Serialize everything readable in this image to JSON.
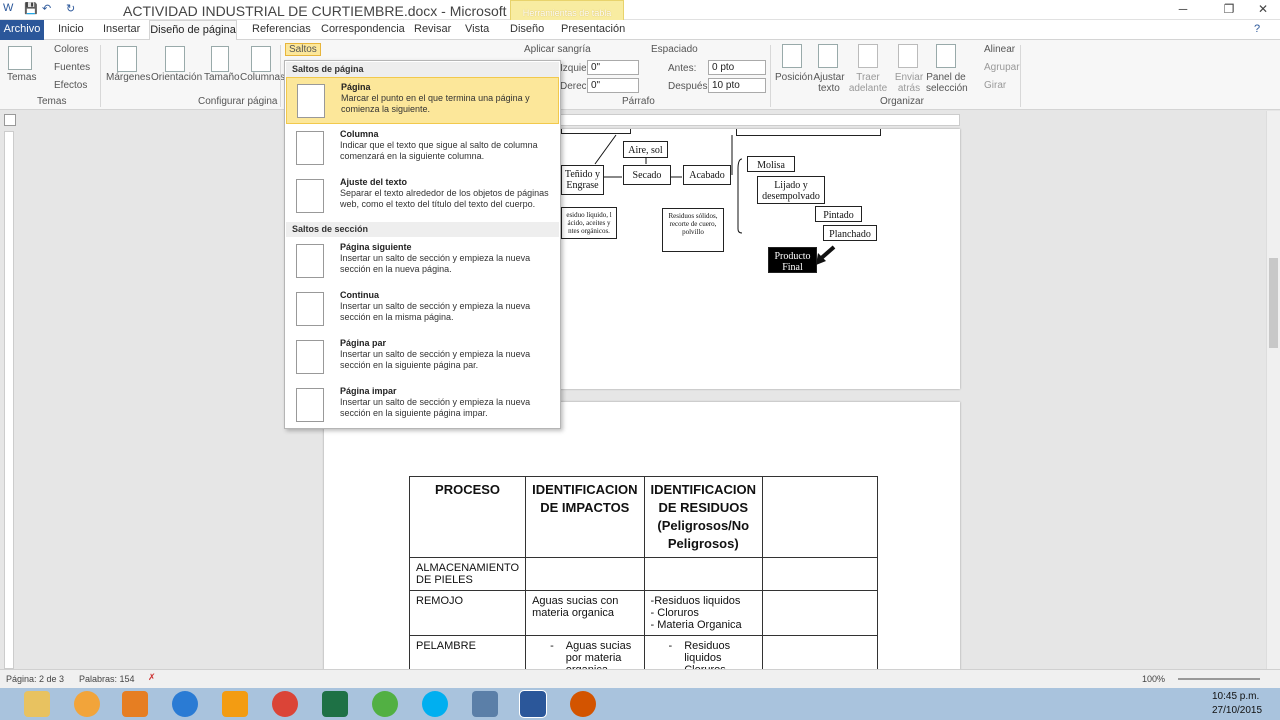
{
  "titlebar": {
    "doc_title": "ACTIVIDAD INDUSTRIAL DE CURTIEMBRE.docx - Microsoft Word",
    "context_tab": "Herramientas de tabla",
    "qa_save": "💾",
    "qa_undo": "↶",
    "qa_redo": "↻",
    "win_help": "?",
    "win_min": "─",
    "win_max": "❐",
    "win_close": "✕"
  },
  "tabs": {
    "file": "Archivo",
    "home": "Inicio",
    "insert": "Insertar",
    "layout": "Diseño de página",
    "references": "Referencias",
    "mailings": "Correspondencia",
    "review": "Revisar",
    "view": "Vista",
    "design": "Diseño",
    "presentation": "Presentación"
  },
  "ribbon": {
    "themes": "Temas",
    "colors": "Colores",
    "fonts": "Fuentes",
    "effects": "Efectos",
    "themes_group": "Temas",
    "margins": "Márgenes",
    "orientation": "Orientación",
    "size": "Tamaño",
    "columns": "Columnas",
    "setup_group": "Configurar página",
    "breaks": "Saltos",
    "indent": "Aplicar sangría",
    "spacing": "Espaciado",
    "left_label": "Izquierda:",
    "left_val": "0\"",
    "right_label": "Derecha:",
    "right_val": "0\"",
    "before_label": "Antes:",
    "before_val": "0 pto",
    "after_label": "Después:",
    "after_val": "10 pto",
    "paragraph_group": "Párrafo",
    "position": "Posición",
    "wrap": "Ajustar texto",
    "bring": "Traer adelante",
    "send": "Enviar atrás",
    "selection": "Panel de selección",
    "align": "Alinear",
    "group": "Agrupar",
    "rotate": "Girar",
    "arrange_group": "Organizar"
  },
  "dropdown": {
    "page_breaks_header": "Saltos de página",
    "section_breaks_header": "Saltos de sección",
    "items": [
      {
        "title": "Página",
        "desc": "Marcar el punto en el que termina una página y comienza la siguiente."
      },
      {
        "title": "Columna",
        "desc": "Indicar que el texto que sigue al salto de columna comenzará en la siguiente columna."
      },
      {
        "title": "Ajuste del texto",
        "desc": "Separar el texto alrededor de los objetos de páginas web, como el texto del título del texto del cuerpo."
      },
      {
        "title": "Página siguiente",
        "desc": "Insertar un salto de sección y empieza la nueva sección en la nueva página."
      },
      {
        "title": "Continua",
        "desc": "Insertar un salto de sección y empieza la nueva sección en la misma página."
      },
      {
        "title": "Página par",
        "desc": "Insertar un salto de sección y empieza la nueva sección en la siguiente página par."
      },
      {
        "title": "Página impar",
        "desc": "Insertar un salto de sección y empieza la nueva sección en la siguiente página impar."
      }
    ]
  },
  "flow": {
    "air": "Aire, sol",
    "dye": "Teñido y Engrase",
    "dry": "Secado",
    "finish": "Acabado",
    "molisa": "Molisa",
    "sand": "Lijado y desempolvado",
    "paint": "Pintado",
    "iron": "Planchado",
    "product": "Producto Final",
    "waste1": "esiduo líquido, l ácido, aceites y ntes orgánicos.",
    "waste2": "Residuos sólidos, recorte de cuero, polvillo"
  },
  "table": {
    "headers": [
      "PROCESO",
      "IDENTIFICACION DE IMPACTOS",
      "IDENTIFICACION DE RESIDUOS (Peligrosos/No Peligrosos)",
      ""
    ],
    "r1": [
      "ALMACENAMIENTO DE PIELES",
      "",
      ""
    ],
    "r2": [
      "REMOJO",
      "Aguas sucias con materia organica",
      "-Residuos liquidos",
      "- Cloruros",
      "- Materia Organica"
    ],
    "r3": [
      "PELAMBRE",
      "-",
      "Aguas sucias por materia organica",
      "-",
      "Residuos liquidos",
      "-",
      "Cloruros"
    ]
  },
  "status": {
    "page": "Página: 2 de 3",
    "words": "Palabras: 154",
    "zoom": "100%",
    "time": "10:45 p.m.",
    "date": "27/10/2015"
  }
}
